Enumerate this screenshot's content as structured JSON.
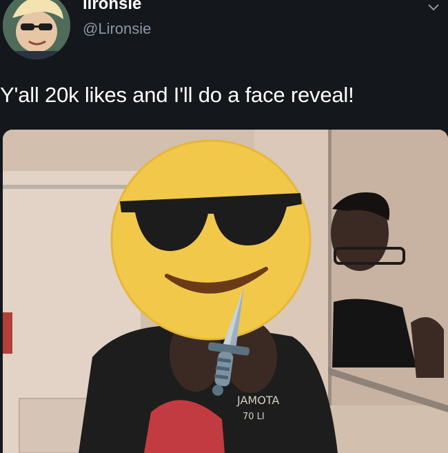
{
  "tweet": {
    "display_name": "lironsie",
    "handle": "@Lironsie",
    "text": "Y'all 20k likes and I'll do a face reveal!"
  },
  "icons": {
    "avatar": "avatar-photo",
    "menu": "chevron-down-icon"
  },
  "media": {
    "description_icons": [
      "sunglasses-face-emoji",
      "dagger-emoji"
    ],
    "shirt_text": "JAMOTA 70 LI"
  },
  "colors": {
    "background": "#14171c",
    "handle": "#8c98a3",
    "emoji_yellow": "#f2c84b"
  }
}
